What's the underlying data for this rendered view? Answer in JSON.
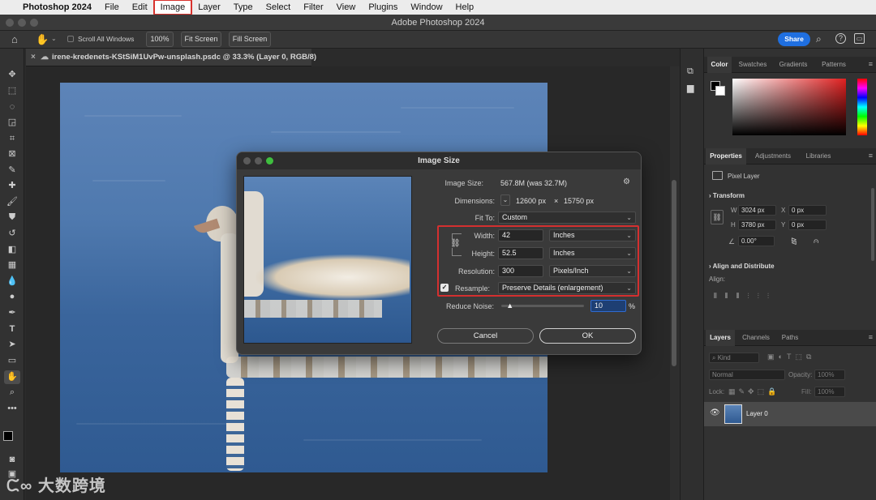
{
  "menubar": {
    "app_name": "Photoshop 2024",
    "items": [
      "File",
      "Edit",
      "Image",
      "Layer",
      "Type",
      "Select",
      "Filter",
      "View",
      "Plugins",
      "Window",
      "Help"
    ]
  },
  "window": {
    "title": "Adobe Photoshop 2024"
  },
  "options_bar": {
    "scroll_all_windows": "Scroll All Windows",
    "zoom_100": "100%",
    "fit_screen": "Fit Screen",
    "fill_screen": "Fill Screen",
    "share": "Share"
  },
  "document": {
    "tab_title": "irene-kredenets-KStSiM1UvPw-unsplash.psdc @ 33.3% (Layer 0, RGB/8)"
  },
  "dialog": {
    "title": "Image Size",
    "image_size_label": "Image Size:",
    "image_size_value": "567.8M (was 32.7M)",
    "dimensions_label": "Dimensions:",
    "dimensions_w": "12600 px",
    "dimensions_x": "×",
    "dimensions_h": "15750 px",
    "fit_to_label": "Fit To:",
    "fit_to_value": "Custom",
    "width_label": "Width:",
    "width_value": "42",
    "width_unit": "Inches",
    "height_label": "Height:",
    "height_value": "52.5",
    "height_unit": "Inches",
    "resolution_label": "Resolution:",
    "resolution_value": "300",
    "resolution_unit": "Pixels/Inch",
    "resample_label": "Resample:",
    "resample_value": "Preserve Details (enlargement)",
    "reduce_noise_label": "Reduce Noise:",
    "reduce_noise_value": "10",
    "reduce_noise_unit": "%",
    "reduce_noise_level": 0.1,
    "cancel": "Cancel",
    "ok": "OK"
  },
  "panels": {
    "color_tabs": [
      "Color",
      "Swatches",
      "Gradients",
      "Patterns"
    ],
    "prop_tabs": [
      "Properties",
      "Adjustments",
      "Libraries"
    ],
    "pixel_layer": "Pixel Layer",
    "transform": "Transform",
    "w_label": "W",
    "w_value": "3024 px",
    "x_label": "X",
    "x_value": "0 px",
    "h_label": "H",
    "h_value": "3780 px",
    "y_label": "Y",
    "y_value": "0 px",
    "angle_value": "0.00°",
    "align_distribute": "Align and Distribute",
    "align_label": "Align:",
    "layer_tabs": [
      "Layers",
      "Channels",
      "Paths"
    ],
    "kind_placeholder": "Kind",
    "blend_mode": "Normal",
    "opacity_label": "Opacity:",
    "opacity_value": "100%",
    "lock_label": "Lock:",
    "fill_label": "Fill:",
    "fill_value": "100%",
    "layer_name": "Layer 0"
  },
  "watermark": "大数跨境",
  "colors": {
    "accent_blue": "#1f6fe0",
    "highlight_red": "#d42f2f"
  }
}
